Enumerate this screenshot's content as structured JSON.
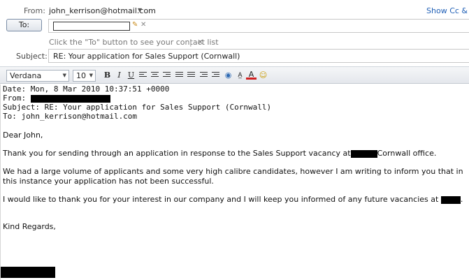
{
  "header": {
    "from_label": "From:",
    "from_value": "john_kerrison@hotmail.com",
    "show_cc": "Show Cc &",
    "to_button": "To:",
    "to_hint": "Click the \"To\" button to see your contact list",
    "hint_separator": "|",
    "subject_label": "Subject:",
    "subject_value": "RE: Your application for Sales Support (Cornwall)"
  },
  "toolbar": {
    "font": "Verdana",
    "size": "10",
    "bold": "B",
    "italic": "I",
    "underline": "U"
  },
  "message": {
    "date_line": "Date: Mon, 8 Mar 2010 10:37:51 +0000",
    "from_line_label": "From:",
    "subject_line": "Subject: RE: Your application for Sales Support (Cornwall)",
    "to_line": "To: john_kerrison@hotmail.com",
    "greeting": "Dear John,",
    "para1_a": "Thank you for sending through an application in response to the Sales Support vacancy at",
    "para1_b": "Cornwall office.",
    "para2": "We had a large volume of applicants and some very high calibre candidates, however I am writing to inform you that in this instance your application has not been successful.",
    "para3_a": "I would like to thank you for your interest in our company and I will keep you informed of any future vacancies at",
    "para3_b": ".",
    "closing": "Kind Regards,"
  }
}
